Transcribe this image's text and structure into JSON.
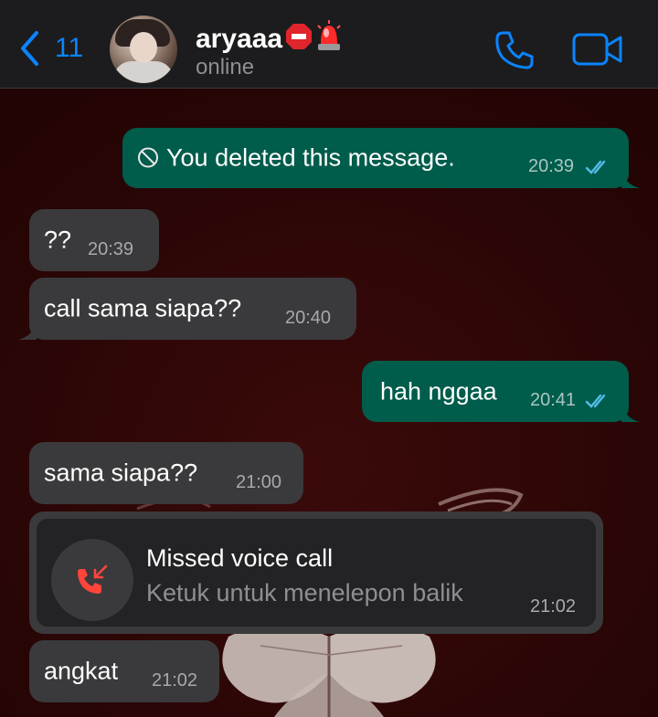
{
  "header": {
    "back_count": "11",
    "contact_name": "aryaaa",
    "status": "online"
  },
  "messages": [
    {
      "direction": "out",
      "text": "You deleted this message.",
      "time": "20:39",
      "deleted": true
    },
    {
      "direction": "in",
      "text": "??",
      "time": "20:39"
    },
    {
      "direction": "in",
      "text": "call sama siapa??",
      "time": "20:40"
    },
    {
      "direction": "out",
      "text": "hah nggaa",
      "time": "20:41"
    },
    {
      "direction": "in",
      "text": "sama siapa??",
      "time": "21:00"
    },
    {
      "direction": "in",
      "text": "angkat",
      "time": "21:02"
    }
  ],
  "missed_call": {
    "title": "Missed voice call",
    "subtitle": "Ketuk untuk menelepon balik",
    "time": "21:02"
  },
  "colors": {
    "accent": "#0a84ff",
    "outgoing_bubble": "#005c4b",
    "incoming_bubble": "#3a3a3c",
    "read_ticks": "#53bdeb",
    "missed_call_red": "#ff453a"
  },
  "icons": {
    "back": "chevron-left-icon",
    "voice_call": "phone-icon",
    "video_call": "video-camera-icon",
    "deleted": "prohibited-icon",
    "missed_call": "missed-call-icon",
    "name_emojis": [
      "stop-sign-emoji",
      "police-light-emoji"
    ]
  }
}
